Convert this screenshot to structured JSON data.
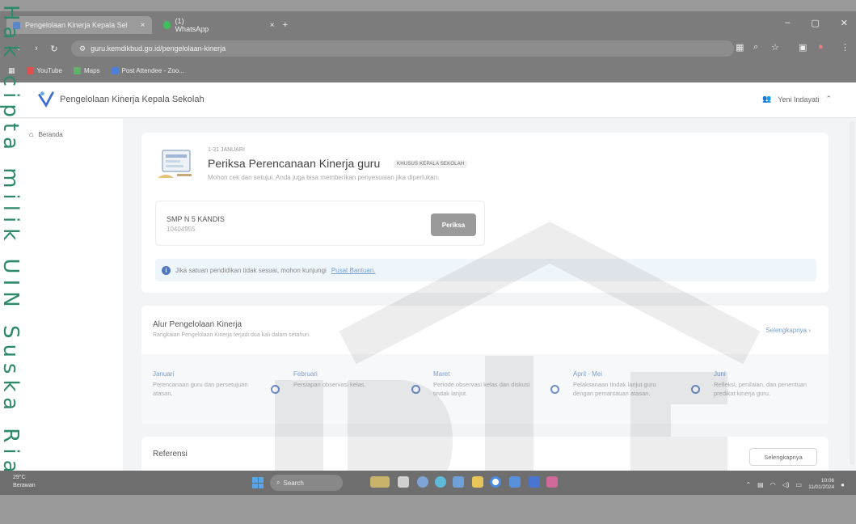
{
  "watermark": {
    "text": "Hak cipta milik UIN Suska Riau"
  },
  "browser": {
    "tabs": [
      {
        "label": "Pengelolaan Kinerja Kepala Sel",
        "close": "×"
      },
      {
        "label": "(1) WhatsApp",
        "close": "×"
      }
    ],
    "new_tab": "+",
    "window_controls": {
      "minimize": "–",
      "maximize": "▢",
      "close": "✕"
    },
    "url": "guru.kemdikbud.go.id/pengelolaan-kinerja",
    "bookmarks": [
      {
        "label": "YouTube",
        "color": "#e05050"
      },
      {
        "label": "Maps",
        "color": "#5fb46a"
      },
      {
        "label": "Post Attendee - Zoo...",
        "color": "#4d7fd6"
      }
    ]
  },
  "app": {
    "title": "Pengelolaan Kinerja Kepala Sekolah",
    "user_name": "Yeni Indayati",
    "sidebar": {
      "items": [
        {
          "label": "Beranda"
        }
      ]
    }
  },
  "planning_card": {
    "date_range": "1-31 JANUARI",
    "title": "Periksa Perencanaan Kinerja guru",
    "badge": "KHUSUS KEPALA SEKOLAH",
    "subtitle": "Mohon cek dan setujui. Anda juga bisa memberikan penyesuaian jika diperlukan.",
    "school": {
      "name": "SMP N 5 KANDIS",
      "npsn": "10404955"
    },
    "action_label": "Periksa",
    "info_text": "Jika satuan pendidikan tidak sesuai, mohon kunjungi",
    "info_link": "Pusat Bantuan."
  },
  "flow_card": {
    "title": "Alur Pengelolaan Kinerja",
    "subtitle": "Rangkaian Pengelolaan Kinerja terjadi dua kali dalam setahun.",
    "more_label": "Selengkapnya  ›",
    "steps": [
      {
        "month": "Januari",
        "desc": "Perencanaan guru dan persetujuan atasan."
      },
      {
        "month": "Februari",
        "desc": "Persiapan observasi kelas."
      },
      {
        "month": "Maret",
        "desc": "Periode observasi kelas dan diskusi tindak lanjut."
      },
      {
        "month": "April - Mei",
        "desc": "Pelaksanaan tindak lanjut guru dengan pemantauan atasan."
      },
      {
        "month": "Juni",
        "desc": "Refleksi, penilaian, dan penentuan predikat kinerja guru."
      }
    ]
  },
  "reference_card": {
    "title": "Referensi",
    "more_label": "Selengkapnya"
  },
  "taskbar": {
    "weather_temp": "29°C",
    "weather_desc": "Berawan",
    "search_label": "Search",
    "time": "10:06",
    "date": "11/01/2024"
  }
}
